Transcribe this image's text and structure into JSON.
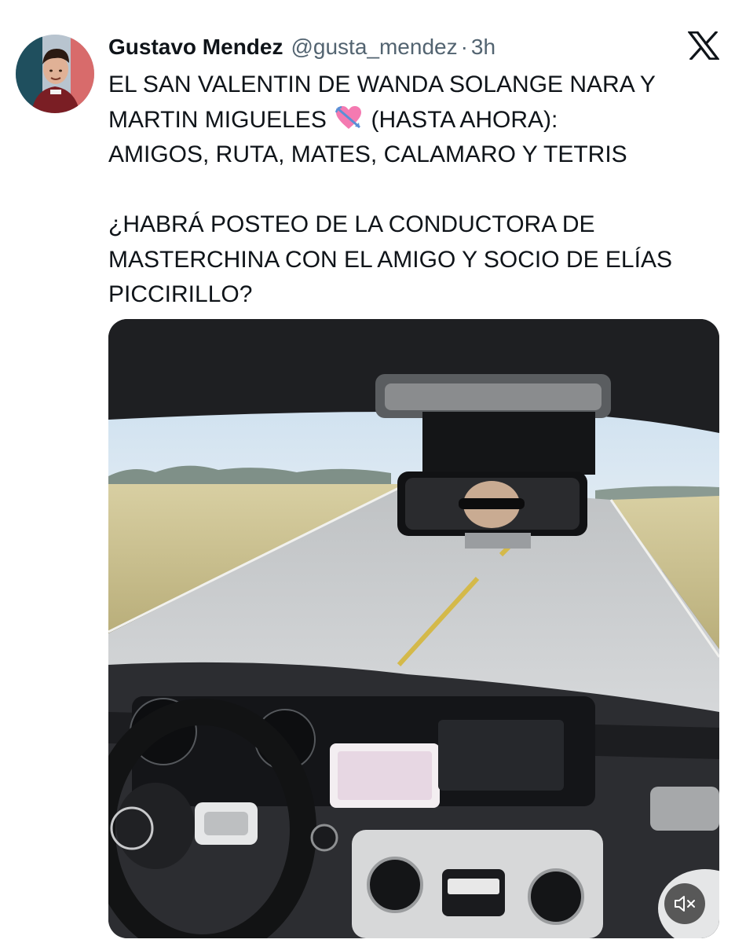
{
  "tweet": {
    "author_name": "Gustavo Mendez",
    "author_handle": "@gusta_mendez",
    "separator": "·",
    "time": "3h",
    "text_line1": "EL SAN VALENTIN DE WANDA SOLANGE NARA Y",
    "text_line2a": "MARTIN MIGUELES",
    "text_line2b": "(HASTA AHORA):",
    "text_line3": "AMIGOS, RUTA, MATES, CALAMARO Y TETRIS",
    "text_para2": "¿HABRÁ POSTEO DE LA CONDUCTORA DE MASTERCHINA CON EL AMIGO Y SOCIO DE ELÍAS PICCIRILLO?"
  },
  "icons": {
    "platform_logo": "x-logo-icon",
    "emoji": "heart-with-arrow-icon",
    "mute": "speaker-muted-icon"
  },
  "colors": {
    "text": "#0f1419",
    "secondary_text": "#536471",
    "background": "#ffffff"
  }
}
